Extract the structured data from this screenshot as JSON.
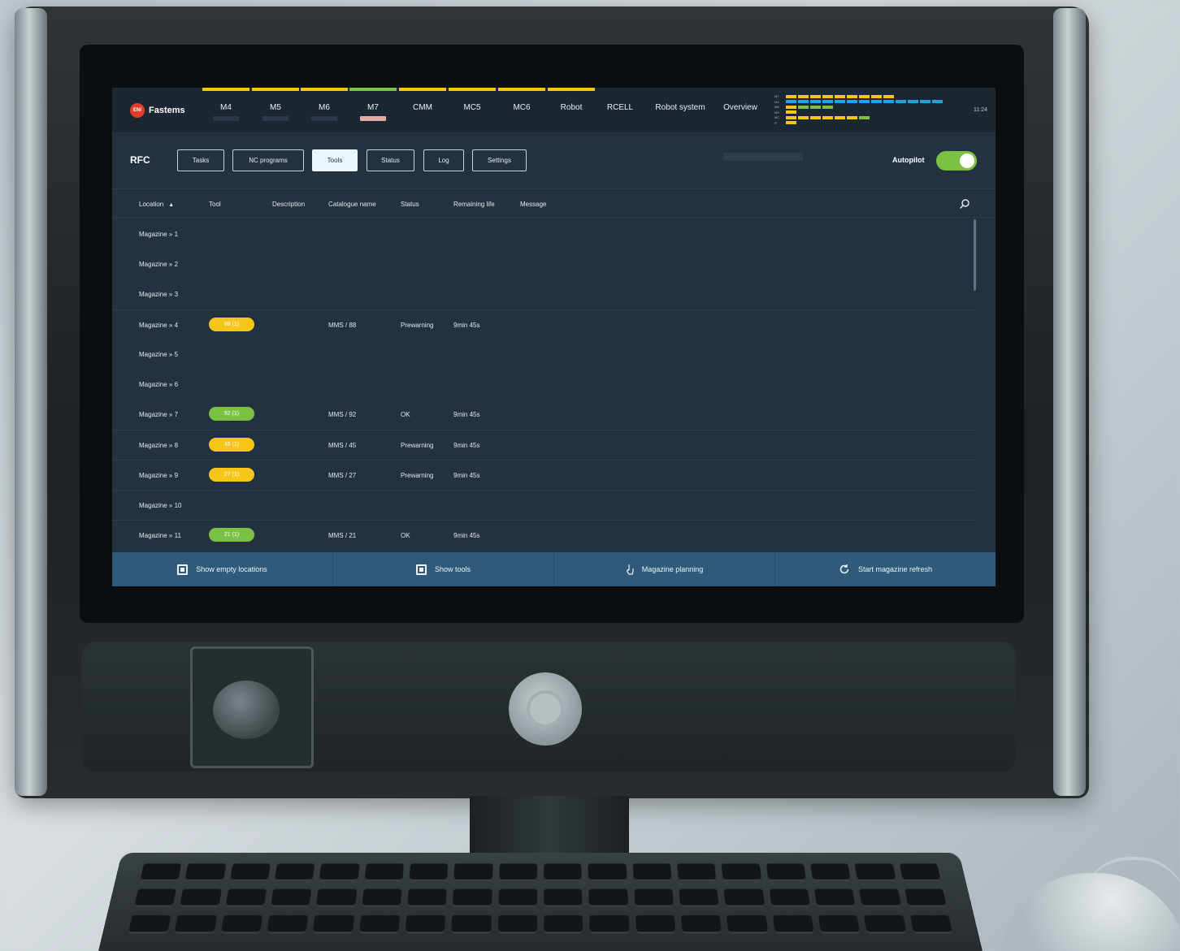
{
  "brand": {
    "logo_mark": "ENI",
    "name": "Fastems"
  },
  "machine_tabs": [
    {
      "label": "M4",
      "accent": "#f5c518",
      "indicator": false
    },
    {
      "label": "M5",
      "accent": "#f5c518",
      "indicator": false
    },
    {
      "label": "M6",
      "accent": "#f5c518",
      "indicator": false
    },
    {
      "label": "M7",
      "accent": "#7cc242",
      "indicator": true
    },
    {
      "label": "CMM",
      "accent": "#f5c518",
      "indicator": false
    },
    {
      "label": "MC5",
      "accent": "#f5c518",
      "indicator": false
    },
    {
      "label": "MC6",
      "accent": "#f5c518",
      "indicator": false
    },
    {
      "label": "Robot",
      "accent": "#f5c518",
      "indicator": false
    },
    {
      "label": "RCELL",
      "accent": "",
      "indicator": false
    },
    {
      "label": "Robot system",
      "accent": "",
      "indicator": false
    },
    {
      "label": "Overview",
      "accent": "",
      "indicator": false
    }
  ],
  "clock": "11:24",
  "section_title": "RFC",
  "nav_buttons": [
    {
      "label": "Tasks",
      "active": false
    },
    {
      "label": "NC programs",
      "active": false
    },
    {
      "label": "Tools",
      "active": true
    },
    {
      "label": "Status",
      "active": false
    },
    {
      "label": "Log",
      "active": false
    },
    {
      "label": "Settings",
      "active": false
    }
  ],
  "autopilot": {
    "label": "Autopilot",
    "on": true
  },
  "table": {
    "columns": [
      "Location",
      "Tool",
      "Description",
      "Catalogue name",
      "Status",
      "Remaining life",
      "Message"
    ],
    "sort_indicator": "▲",
    "rows": [
      {
        "location": "Magazine » 1",
        "tool": "",
        "description": "",
        "catalogue": "",
        "status": "",
        "life": "",
        "message": "",
        "pill": ""
      },
      {
        "location": "Magazine » 2",
        "tool": "",
        "description": "",
        "catalogue": "",
        "status": "",
        "life": "",
        "message": "",
        "pill": ""
      },
      {
        "location": "Magazine » 3",
        "tool": "",
        "description": "",
        "catalogue": "",
        "status": "",
        "life": "",
        "message": "",
        "pill": ""
      },
      {
        "location": "Magazine » 4",
        "tool": "88 (1)",
        "description": "",
        "catalogue": "MMS / 88",
        "status": "Prewarning",
        "life": "9min 45s",
        "message": "",
        "pill": "#f5c518"
      },
      {
        "location": "Magazine » 5",
        "tool": "",
        "description": "",
        "catalogue": "",
        "status": "",
        "life": "",
        "message": "",
        "pill": ""
      },
      {
        "location": "Magazine » 6",
        "tool": "",
        "description": "",
        "catalogue": "",
        "status": "",
        "life": "",
        "message": "",
        "pill": ""
      },
      {
        "location": "Magazine » 7",
        "tool": "92 (1)",
        "description": "",
        "catalogue": "MMS / 92",
        "status": "OK",
        "life": "9min 45s",
        "message": "",
        "pill": "#7cc242"
      },
      {
        "location": "Magazine » 8",
        "tool": "45 (1)",
        "description": "",
        "catalogue": "MMS / 45",
        "status": "Prewarning",
        "life": "9min 45s",
        "message": "",
        "pill": "#f5c518"
      },
      {
        "location": "Magazine » 9",
        "tool": "27 (1)",
        "description": "",
        "catalogue": "MMS / 27",
        "status": "Prewarning",
        "life": "9min 45s",
        "message": "",
        "pill": "#f5c518"
      },
      {
        "location": "Magazine » 10",
        "tool": "",
        "description": "",
        "catalogue": "",
        "status": "",
        "life": "",
        "message": "",
        "pill": ""
      },
      {
        "location": "Magazine » 11",
        "tool": "21 (1)",
        "description": "",
        "catalogue": "MMS / 21",
        "status": "OK",
        "life": "9min 45s",
        "message": "",
        "pill": "#7cc242"
      }
    ]
  },
  "footer": {
    "show_empty": "Show empty locations",
    "show_tools": "Show tools",
    "magazine_planning": "Magazine planning",
    "start_refresh": "Start magazine refresh"
  },
  "minichart_rows": [
    {
      "label": "M7",
      "colors": [
        "#f5c518",
        "#f5c518",
        "#f5c518",
        "#f5c518",
        "#f5c518",
        "#f5c518",
        "#f5c518",
        "#f5c518",
        "#f5c518"
      ]
    },
    {
      "label": "M4",
      "colors": [
        "#2a9fe0",
        "#2a9fe0",
        "#2a9fe0",
        "#2a9fe0",
        "#2a9fe0",
        "#2a9fe0",
        "#2a9fe0",
        "#2a9fe0",
        "#2a9fe0",
        "#2a9fe0",
        "#2a9fe0",
        "#2a9fe0",
        "#2a9fe0"
      ]
    },
    {
      "label": "M5",
      "colors": [
        "#f5c518",
        "#7cc242",
        "#7cc242",
        "#7cc242"
      ]
    },
    {
      "label": "M6",
      "colors": [
        "#f5c518"
      ]
    },
    {
      "label": "MC",
      "colors": [
        "#f5c518",
        "#f5c518",
        "#f5c518",
        "#f5c518",
        "#f5c518",
        "#f5c518",
        "#7cc242"
      ]
    },
    {
      "label": "R",
      "colors": [
        "#f5c518"
      ]
    }
  ]
}
